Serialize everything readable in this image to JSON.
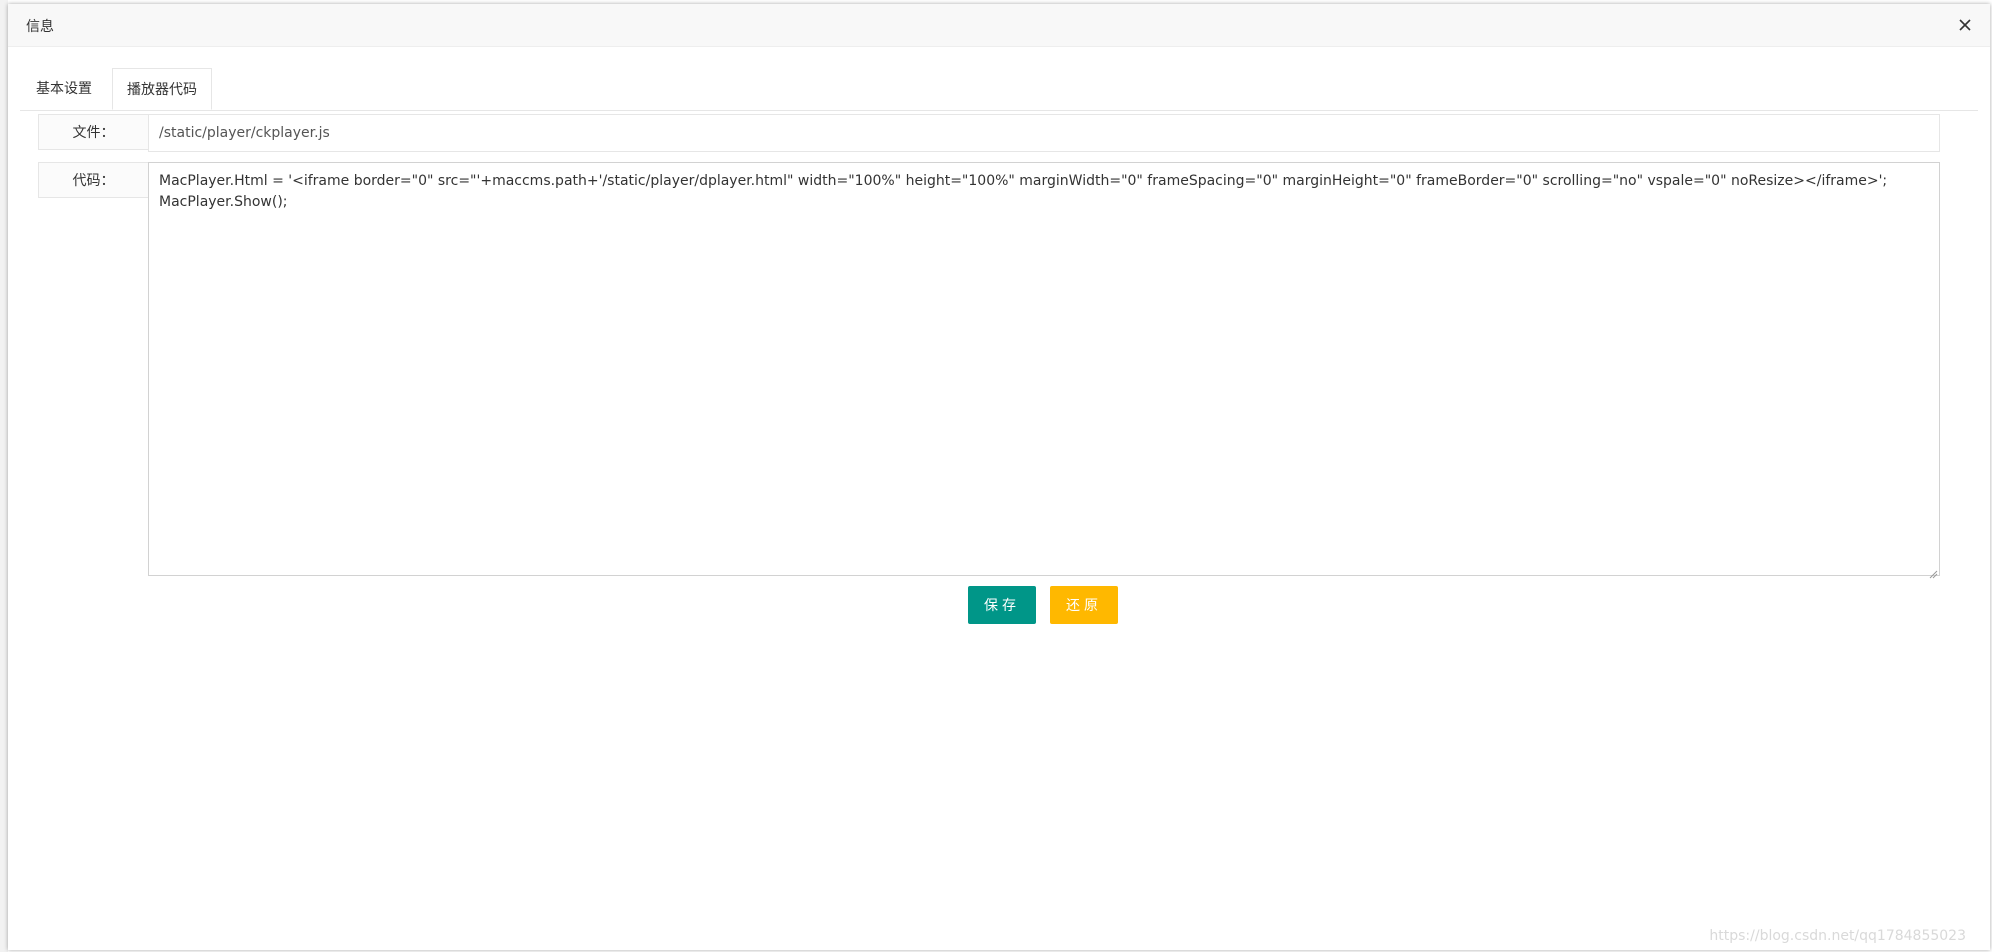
{
  "dialog": {
    "title": "信息",
    "close_icon": "close-icon"
  },
  "tabs": [
    {
      "label": "基本设置",
      "active": false
    },
    {
      "label": "播放器代码",
      "active": true
    }
  ],
  "form": {
    "file_label": "文件：",
    "file_value": "/static/player/ckplayer.js",
    "code_label": "代码：",
    "code_value": "MacPlayer.Html = '<iframe border=\"0\" src=\"'+maccms.path+'/static/player/dplayer.html\" width=\"100%\" height=\"100%\" marginWidth=\"0\" frameSpacing=\"0\" marginHeight=\"0\" frameBorder=\"0\" scrolling=\"no\" vspale=\"0\" noResize></iframe>';\nMacPlayer.Show();"
  },
  "buttons": {
    "save_label": "保存",
    "reset_label": "还原"
  },
  "colors": {
    "save": "#009688",
    "reset": "#FFB800"
  },
  "watermark": "https://blog.csdn.net/qq1784855023"
}
